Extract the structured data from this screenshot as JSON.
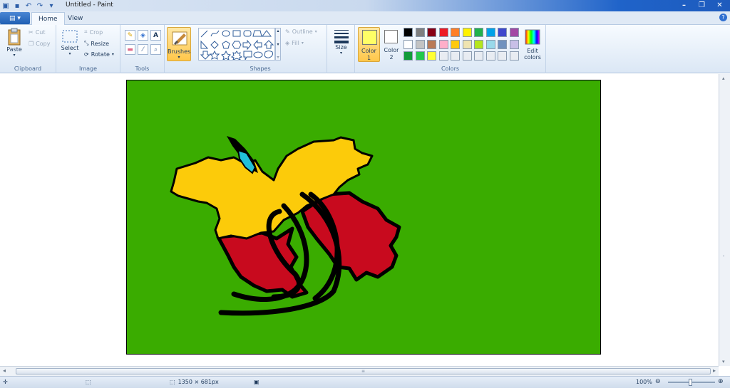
{
  "window": {
    "title": "Untitled - Paint",
    "controls": [
      "minimize",
      "maximize",
      "close"
    ]
  },
  "tabs": [
    {
      "label": "Home",
      "active": true
    },
    {
      "label": "View",
      "active": false
    }
  ],
  "ribbon": {
    "clipboard": {
      "label": "Clipboard",
      "paste": "Paste",
      "cut": "Cut",
      "copy": "Copy"
    },
    "image": {
      "label": "Image",
      "select": "Select",
      "crop": "Crop",
      "resize": "Resize",
      "rotate": "Rotate"
    },
    "tools": {
      "label": "Tools"
    },
    "brushes": {
      "label": "Brushes"
    },
    "shapes": {
      "label": "Shapes",
      "outline": "Outline",
      "fill": "Fill"
    },
    "size": {
      "label": "Size"
    },
    "colors": {
      "label": "Colors",
      "color1": "Color\n1",
      "color1_line1": "Color",
      "color1_line2": "1",
      "color2_line1": "Color",
      "color2_line2": "2",
      "edit": "Edit colors",
      "edit_line1": "Edit",
      "edit_line2": "colors",
      "color1_value": "#ffff66",
      "color2_value": "#ffffff",
      "palette_row1": [
        "#000000",
        "#7f7f7f",
        "#880015",
        "#ed1c24",
        "#ff7f27",
        "#fff200",
        "#22b14c",
        "#00a2e8",
        "#3f48cc",
        "#a349a4"
      ],
      "palette_row2": [
        "#ffffff",
        "#c3c3c3",
        "#b97a57",
        "#ffaec9",
        "#ffc90e",
        "#efe4b0",
        "#b5e61d",
        "#99d9ea",
        "#7092be",
        "#c8bfe7"
      ],
      "palette_row3": [
        "#129b3a",
        "#22c84a",
        "#ffff33",
        "#e8ecf2",
        "#e8ecf2",
        "#e8ecf2",
        "#e8ecf2",
        "#e8ecf2",
        "#e8ecf2",
        "#e8ecf2"
      ]
    }
  },
  "canvas": {
    "background": "#3aac00",
    "yellow": "#fccb0a",
    "red": "#c80a1e",
    "cyan": "#22c0d8",
    "stroke": "#000000"
  },
  "statusbar": {
    "dimensions": "1350 × 681px",
    "zoom": "100%"
  }
}
